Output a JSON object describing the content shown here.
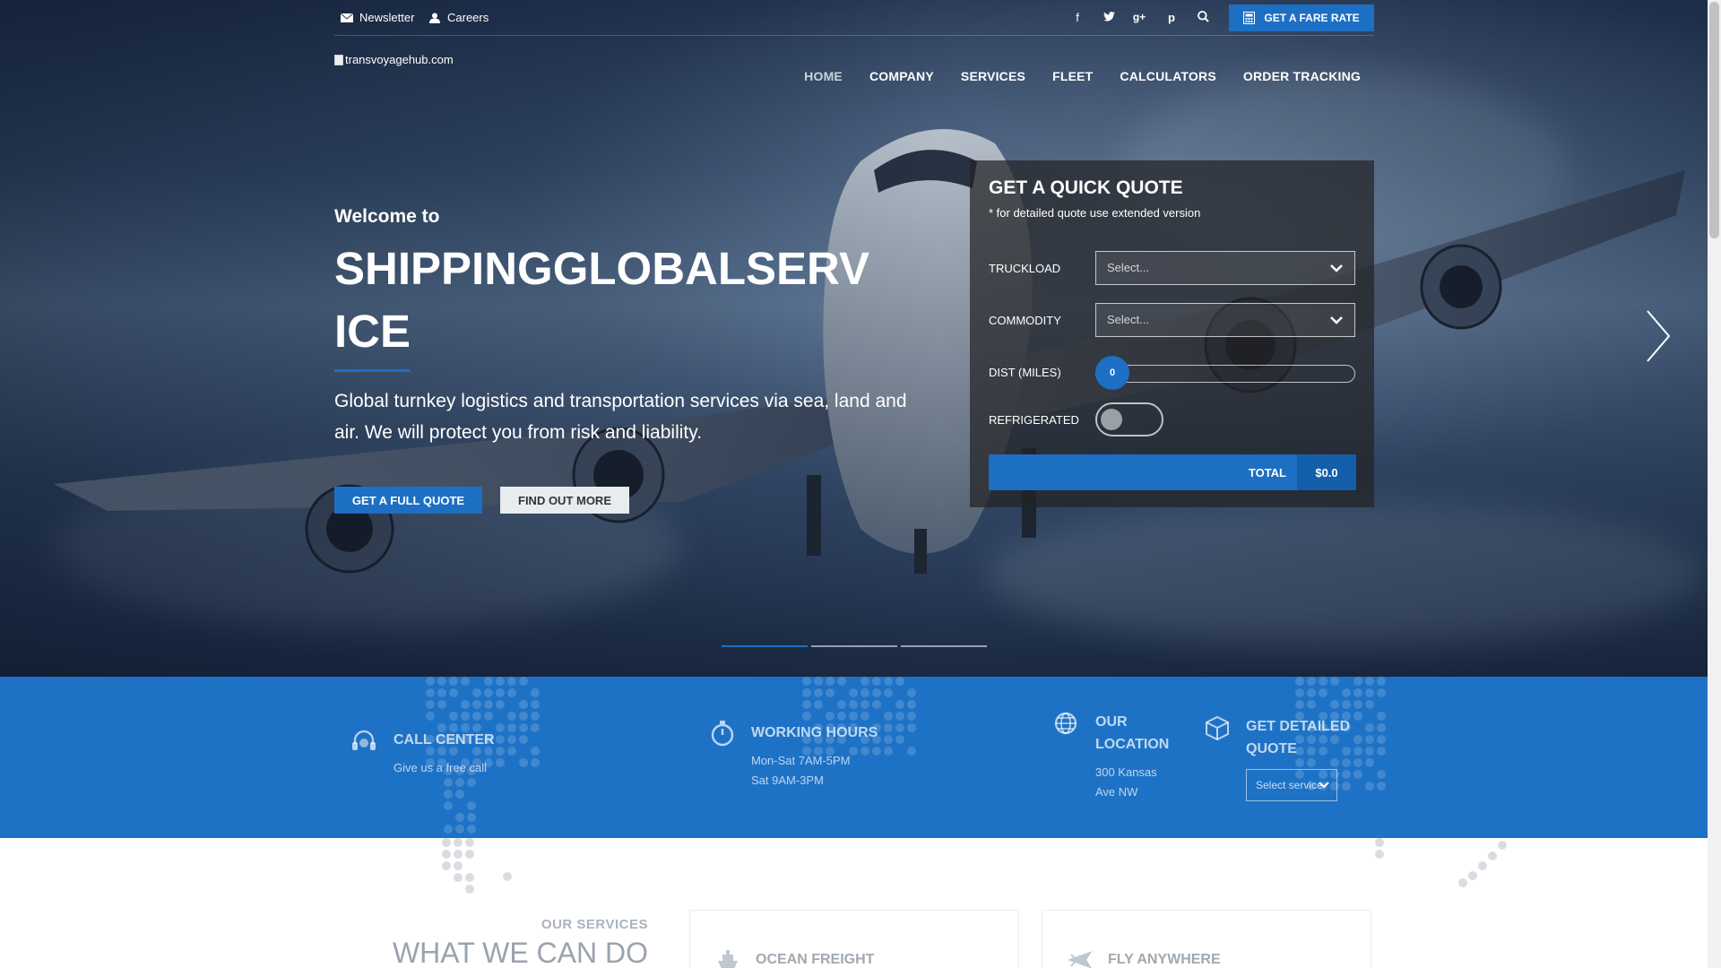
{
  "topbar": {
    "newsletter": "Newsletter",
    "careers": "Careers",
    "social": [
      "facebook-icon",
      "twitter-icon",
      "google-plus-icon",
      "pinterest-icon",
      "search-icon"
    ],
    "fare_button": "GET A FARE RATE"
  },
  "logo": {
    "alt": "transvoyagehub.com"
  },
  "nav": {
    "items": [
      "HOME",
      "COMPANY",
      "SERVICES",
      "FLEET",
      "CALCULATORS",
      "ORDER TRACKING"
    ],
    "active": "HOME"
  },
  "hero": {
    "welcome": "Welcome to",
    "headline": "SHIPPINGGLOBALSERVICE",
    "lead": "Global turnkey logistics and transportation services via sea, land and air. We will protect you from risk and liability.",
    "btn_full_quote": "GET A FULL QUOTE",
    "btn_find_out": "FIND OUT MORE",
    "slides": 3,
    "active_slide": 1
  },
  "quote": {
    "title": "GET A QUICK QUOTE",
    "note": "* for detailed quote use extended version",
    "truckload_label": "TRUCKLOAD",
    "truckload_value": "Select...",
    "commodity_label": "COMMODITY",
    "commodity_value": "Select...",
    "distance_label": "DIST (MILES)",
    "distance_value": "0",
    "refrigerated_label": "REFRIGERATED",
    "refrigerated_on": false,
    "total_label": "TOTAL",
    "total_value": "$0.0"
  },
  "info": {
    "call": {
      "title": "CALL CENTER",
      "text": "Give us a free call"
    },
    "hours": {
      "title": "WORKING HOURS",
      "line1": "Mon-Sat 7AM-5PM",
      "line2": "Sat 9AM-3PM"
    },
    "location": {
      "title1": "OUR",
      "title2": "LOCATION",
      "line1": "300 Kansas",
      "line2": "Ave NW"
    },
    "detailed": {
      "title1": "GET DETAILED",
      "title2": "QUOTE",
      "select": "Select service"
    }
  },
  "services": {
    "kicker": "OUR SERVICES",
    "heading": "WHAT WE CAN DO",
    "cards": [
      "OCEAN FREIGHT",
      "FLY ANYWHERE"
    ]
  },
  "colors": {
    "accent": "#1d6fc4",
    "strip": "#1e72c6"
  }
}
